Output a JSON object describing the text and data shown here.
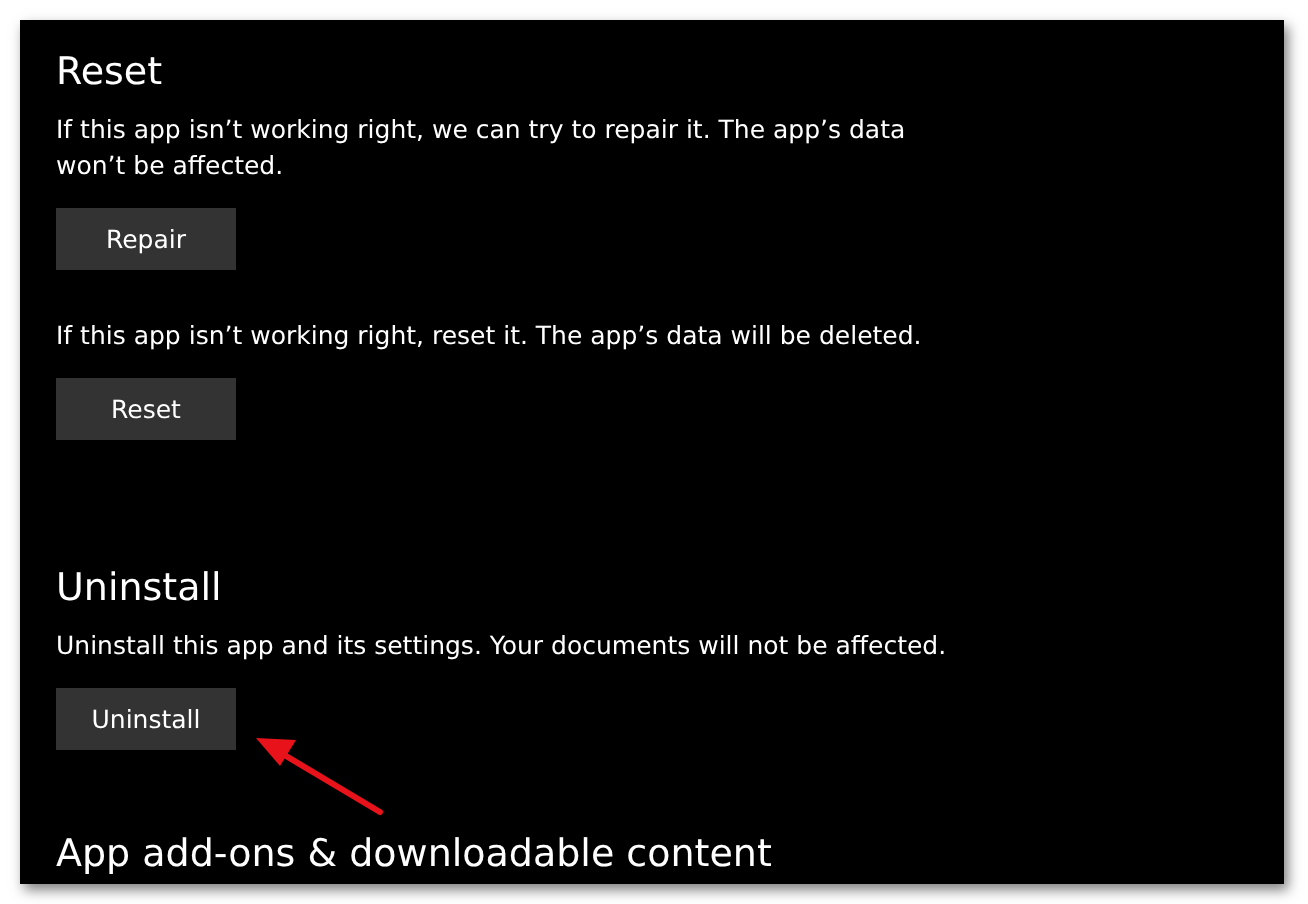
{
  "sections": [
    {
      "heading": "Reset",
      "items": [
        {
          "description": "If this app isn’t working right, we can try to repair it. The app’s data won’t be affected.",
          "button": "Repair"
        },
        {
          "description": "If this app isn’t working right, reset it. The app’s data will be deleted.",
          "button": "Reset"
        }
      ]
    },
    {
      "heading": "Uninstall",
      "items": [
        {
          "description": "Uninstall this app and its settings. Your documents will not be affected.",
          "button": "Uninstall"
        }
      ]
    },
    {
      "heading": "App add-ons & downloadable content"
    }
  ],
  "annotation": {
    "kind": "arrow"
  }
}
